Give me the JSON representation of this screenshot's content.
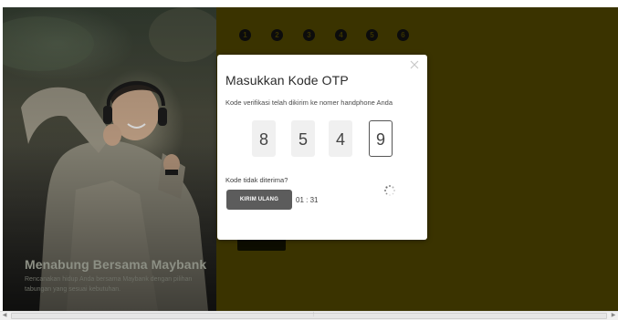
{
  "hero": {
    "title": "Menabung Bersama Maybank",
    "description": "Rencanakan hidup Anda bersama Maybank dengan pilihan tabungan yang sesuai kebutuhan."
  },
  "steps": [
    "1",
    "2",
    "3",
    "4",
    "5",
    "6"
  ],
  "background_button": {
    "label": ""
  },
  "modal": {
    "close_icon": "close-icon",
    "title": "Masukkan Kode OTP",
    "subtitle": "Kode verifikasi telah dikirim ke nomer handphone Anda",
    "otp_digits": [
      "8",
      "5",
      "4",
      "9"
    ],
    "resend_label": "Kode tidak diterima?",
    "resend_button": "KIRIM ULANG",
    "timer": "01 : 31",
    "spinner_icon": "loading-spinner-icon"
  },
  "colors": {
    "background_right": "#3a3300",
    "modal_bg": "#ffffff",
    "resend_button_bg": "#5c5c5c"
  }
}
